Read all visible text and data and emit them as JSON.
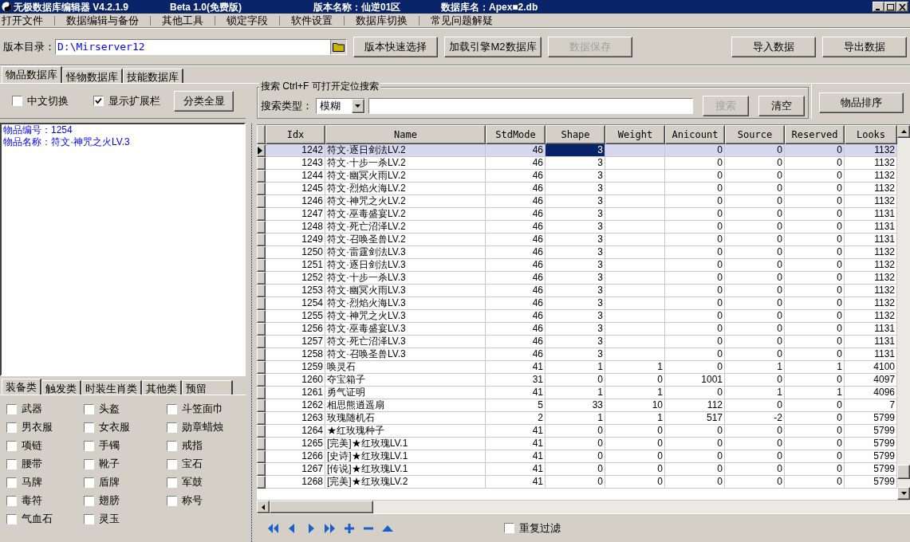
{
  "window": {
    "title": "无极数据库编辑器 V4.2.1.9",
    "edition": "Beta 1.0(免费版)",
    "version_name": "版本名称：仙逆01区",
    "database_name": "数据库名：Apex■2.db"
  },
  "menu": [
    "打开文件",
    "数据编辑与备份",
    "其他工具",
    "锁定字段",
    "软件设置",
    "数据库切换",
    "常见问题解疑"
  ],
  "toolbar": {
    "dir_label": "版本目录：",
    "dir_value": "D:\\Mirserver12",
    "buttons": [
      {
        "label": "版本快速选择",
        "disabled": false
      },
      {
        "label": "加载引擎M2数据库",
        "disabled": false
      },
      {
        "label": "数据保存",
        "disabled": true
      }
    ],
    "right_buttons": [
      {
        "label": "导入数据",
        "disabled": false
      },
      {
        "label": "导出数据",
        "disabled": false
      }
    ]
  },
  "tabs": [
    {
      "label": "物品数据库",
      "selected": true
    },
    {
      "label": "怪物数据库",
      "selected": false
    },
    {
      "label": "技能数据库",
      "selected": false
    }
  ],
  "options": [
    {
      "label": "中文切换",
      "checked": false
    },
    {
      "label": "显示扩展栏",
      "checked": true
    }
  ],
  "show_all_button": "分类全显",
  "info_lines": [
    "物品编号：1254",
    "物品名称：符文·神咒之火LV.3"
  ],
  "search": {
    "title": "搜索  Ctrl+F 可打开定位搜索",
    "type_label": "搜索类型：",
    "type_value": "模糊",
    "search_button": {
      "label": "搜索",
      "disabled": true
    },
    "clear_button": {
      "label": "清空",
      "disabled": false
    }
  },
  "sort_button": "物品排序",
  "category_tabs": [
    {
      "label": "装备类",
      "selected": true
    },
    {
      "label": "触发类",
      "selected": false
    },
    {
      "label": "时装生肖类",
      "selected": false
    },
    {
      "label": "其他类",
      "selected": false
    },
    {
      "label": "预留",
      "selected": false
    }
  ],
  "categories": [
    {
      "label": "武器",
      "checked": false
    },
    {
      "label": "头盔",
      "checked": false
    },
    {
      "label": "斗笠面巾",
      "checked": false
    },
    {
      "label": "男衣服",
      "checked": false
    },
    {
      "label": "女衣服",
      "checked": false
    },
    {
      "label": "勋章蜡烛",
      "checked": false
    },
    {
      "label": "项链",
      "checked": false
    },
    {
      "label": "手镯",
      "checked": false
    },
    {
      "label": "戒指",
      "checked": false
    },
    {
      "label": "腰带",
      "checked": false
    },
    {
      "label": "靴子",
      "checked": false
    },
    {
      "label": "宝石",
      "checked": false
    },
    {
      "label": "马牌",
      "checked": false
    },
    {
      "label": "盾牌",
      "checked": false
    },
    {
      "label": "军鼓",
      "checked": false
    },
    {
      "label": "毒符",
      "checked": false
    },
    {
      "label": "翅膀",
      "checked": false
    },
    {
      "label": "称号",
      "checked": false
    },
    {
      "label": "气血石",
      "checked": false
    },
    {
      "label": "灵玉",
      "checked": false
    }
  ],
  "table": {
    "columns": [
      {
        "label": "Idx",
        "focused": false
      },
      {
        "label": "Name",
        "focused": false
      },
      {
        "label": "StdMode",
        "focused": false
      },
      {
        "label": "Shape",
        "focused": true
      },
      {
        "label": "Weight",
        "focused": false
      },
      {
        "label": "Anicount",
        "focused": false
      },
      {
        "label": "Source",
        "focused": false
      },
      {
        "label": "Reserved",
        "focused": false
      },
      {
        "label": "Looks",
        "focused": false
      }
    ],
    "rows": [
      {
        "selected": true,
        "cells": [
          "1242",
          "符文·逐日剑法LV.2",
          "46",
          "3",
          null,
          "0",
          "0",
          "0",
          "1132"
        ]
      },
      {
        "selected": false,
        "cells": [
          "1243",
          "符文·十步一杀LV.2",
          "46",
          "3",
          null,
          "0",
          "0",
          "0",
          "1132"
        ]
      },
      {
        "selected": false,
        "cells": [
          "1244",
          "符文·幽冥火雨LV.2",
          "46",
          "3",
          null,
          "0",
          "0",
          "0",
          "1132"
        ]
      },
      {
        "selected": false,
        "cells": [
          "1245",
          "符文·烈焰火海LV.2",
          "46",
          "3",
          null,
          "0",
          "0",
          "0",
          "1132"
        ]
      },
      {
        "selected": false,
        "cells": [
          "1246",
          "符文·神咒之火LV.2",
          "46",
          "3",
          null,
          "0",
          "0",
          "0",
          "1132"
        ]
      },
      {
        "selected": false,
        "cells": [
          "1247",
          "符文·巫毒盛宴LV.2",
          "46",
          "3",
          null,
          "0",
          "0",
          "0",
          "1131"
        ]
      },
      {
        "selected": false,
        "cells": [
          "1248",
          "符文·死亡沼泽LV.2",
          "46",
          "3",
          null,
          "0",
          "0",
          "0",
          "1131"
        ]
      },
      {
        "selected": false,
        "cells": [
          "1249",
          "符文·召唤圣兽LV.2",
          "46",
          "3",
          null,
          "0",
          "0",
          "0",
          "1131"
        ]
      },
      {
        "selected": false,
        "cells": [
          "1250",
          "符文·雷霆剑法LV.3",
          "46",
          "3",
          null,
          "0",
          "0",
          "0",
          "1132"
        ]
      },
      {
        "selected": false,
        "cells": [
          "1251",
          "符文·逐日剑法LV.3",
          "46",
          "3",
          null,
          "0",
          "0",
          "0",
          "1132"
        ]
      },
      {
        "selected": false,
        "cells": [
          "1252",
          "符文·十步一杀LV.3",
          "46",
          "3",
          null,
          "0",
          "0",
          "0",
          "1132"
        ]
      },
      {
        "selected": false,
        "cells": [
          "1253",
          "符文·幽冥火雨LV.3",
          "46",
          "3",
          null,
          "0",
          "0",
          "0",
          "1132"
        ]
      },
      {
        "selected": false,
        "cells": [
          "1254",
          "符文·烈焰火海LV.3",
          "46",
          "3",
          null,
          "0",
          "0",
          "0",
          "1132"
        ]
      },
      {
        "selected": false,
        "cells": [
          "1255",
          "符文·神咒之火LV.3",
          "46",
          "3",
          null,
          "0",
          "0",
          "0",
          "1132"
        ]
      },
      {
        "selected": false,
        "cells": [
          "1256",
          "符文·巫毒盛宴LV.3",
          "46",
          "3",
          null,
          "0",
          "0",
          "0",
          "1131"
        ]
      },
      {
        "selected": false,
        "cells": [
          "1257",
          "符文·死亡沼泽LV.3",
          "46",
          "3",
          null,
          "0",
          "0",
          "0",
          "1131"
        ]
      },
      {
        "selected": false,
        "cells": [
          "1258",
          "符文·召唤圣兽LV.3",
          "46",
          "3",
          null,
          "0",
          "0",
          "0",
          "1131"
        ]
      },
      {
        "selected": false,
        "cells": [
          "1259",
          "唤灵石",
          "41",
          "1",
          "1",
          "0",
          "1",
          "1",
          "4100"
        ]
      },
      {
        "selected": false,
        "cells": [
          "1260",
          "夺宝箱子",
          "31",
          "0",
          "0",
          "1001",
          "0",
          "0",
          "4097"
        ]
      },
      {
        "selected": false,
        "cells": [
          "1261",
          "勇气证明",
          "41",
          "1",
          "1",
          "0",
          "1",
          "1",
          "4096"
        ]
      },
      {
        "selected": false,
        "cells": [
          "1262",
          "相思熊逍遥扇",
          "5",
          "33",
          "10",
          "112",
          "0",
          "0",
          "7"
        ]
      },
      {
        "selected": false,
        "cells": [
          "1263",
          "玫瑰随机石",
          "2",
          "1",
          "1",
          "517",
          "-2",
          "0",
          "5799"
        ]
      },
      {
        "selected": false,
        "cells": [
          "1264",
          "★红玫瑰种子",
          "41",
          "0",
          "0",
          "0",
          "0",
          "0",
          "5799"
        ]
      },
      {
        "selected": false,
        "cells": [
          "1265",
          "[完美]★红玫瑰LV.1",
          "41",
          "0",
          "0",
          "0",
          "0",
          "0",
          "5799"
        ]
      },
      {
        "selected": false,
        "cells": [
          "1266",
          "[史诗]★红玫瑰LV.1",
          "41",
          "0",
          "0",
          "0",
          "0",
          "0",
          "5799"
        ]
      },
      {
        "selected": false,
        "cells": [
          "1267",
          "[传说]★红玫瑰LV.1",
          "41",
          "0",
          "0",
          "0",
          "0",
          "0",
          "5799"
        ]
      },
      {
        "selected": false,
        "cells": [
          "1268",
          "[完美]★红玫瑰LV.2",
          "41",
          "0",
          "0",
          "0",
          "0",
          "0",
          "5799"
        ]
      }
    ]
  },
  "navigator": {
    "filter": {
      "label": "重复过滤",
      "checked": false
    }
  }
}
